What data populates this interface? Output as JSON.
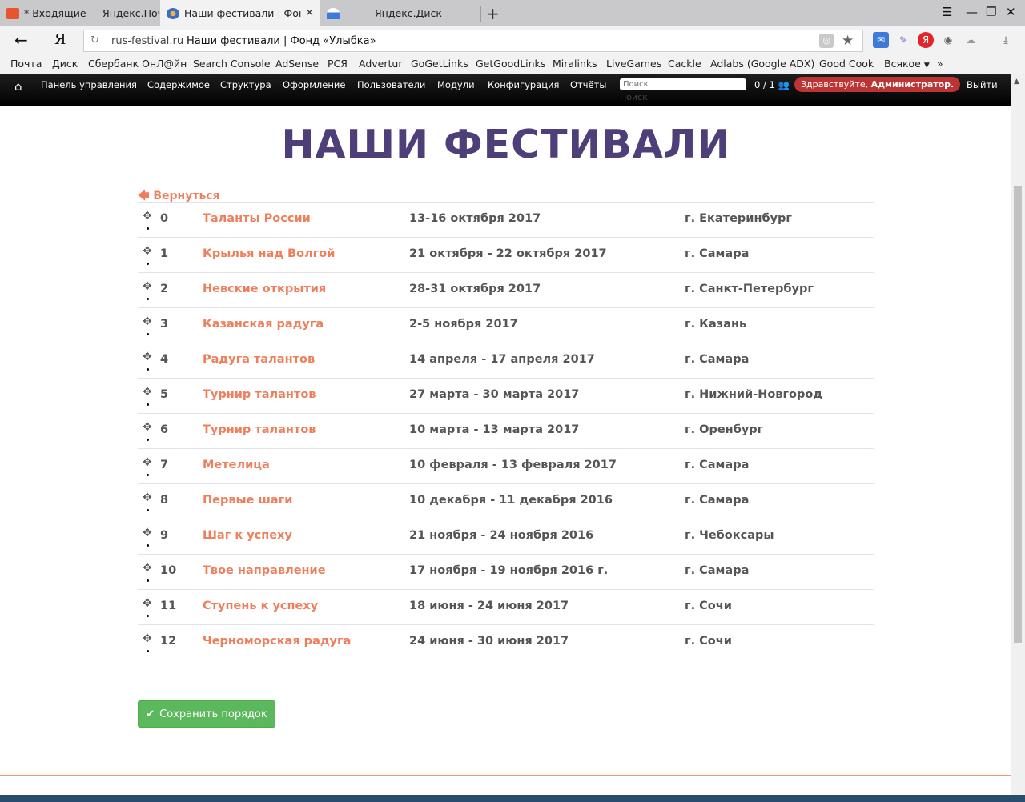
{
  "browser": {
    "tabs": [
      {
        "label": "* Входящие — Яндекс.Почта",
        "active": false
      },
      {
        "label": "Наши фестивали | Фонд «Улыбка»",
        "active": true
      },
      {
        "label": "Яндекс.Диск",
        "active": false
      }
    ],
    "address": {
      "domain": "rus-festival.ru",
      "title": "Наши фестивали | Фонд «Улыбка»"
    },
    "yandex_logo": "Я",
    "bookmarks": [
      "Почта",
      "Диск",
      "Сбербанк ОнЛ@йн",
      "Search Console",
      "AdSense",
      "РСЯ",
      "Advertur",
      "GoGetLinks",
      "GetGoodLinks",
      "Miralinks",
      "LiveGames",
      "Cackle",
      "Adlabs (Google ADX)",
      "Good Cook",
      "Всякое",
      "»"
    ]
  },
  "admin_bar": {
    "menu": [
      "Панель управления",
      "Содержимое",
      "Структура",
      "Оформление",
      "Пользователи",
      "Модули",
      "Конфигурация",
      "Отчёты"
    ],
    "search_placeholder": "Поиск",
    "search_label": "Поиск",
    "user_count": "0 / 1",
    "greeting_prefix": "Здравствуйте,",
    "greeting_user": "Администратор.",
    "logout": "Выйти"
  },
  "page": {
    "title": "НАШИ ФЕСТИВАЛИ",
    "back_link": "Вернуться",
    "save_button": "Сохранить порядок"
  },
  "festivals": [
    {
      "num": "0",
      "name": "Таланты России",
      "date": "13-16 октября 2017",
      "city": "г. Екатеринбург"
    },
    {
      "num": "1",
      "name": "Крылья над Волгой",
      "date": "21 октября - 22 октября 2017",
      "city": "г. Самара"
    },
    {
      "num": "2",
      "name": "Невские открытия",
      "date": "28-31 октября 2017",
      "city": "г. Санкт-Петербург"
    },
    {
      "num": "3",
      "name": "Казанская радуга",
      "date": "2-5 ноября 2017",
      "city": "г. Казань"
    },
    {
      "num": "4",
      "name": "Радуга талантов",
      "date": "14 апреля - 17 апреля 2017",
      "city": "г. Самара"
    },
    {
      "num": "5",
      "name": "Турнир талантов",
      "date": "27 марта - 30 марта 2017",
      "city": "г. Нижний-Новгород"
    },
    {
      "num": "6",
      "name": "Турнир талантов",
      "date": "10 марта - 13 марта 2017",
      "city": "г. Оренбург"
    },
    {
      "num": "7",
      "name": "Метелица",
      "date": "10 февраля - 13 февраля 2017",
      "city": "г. Самара"
    },
    {
      "num": "8",
      "name": "Первые шаги",
      "date": "10 декабря - 11 декабря 2016",
      "city": "г. Самара"
    },
    {
      "num": "9",
      "name": "Шаг к успеху",
      "date": "21 ноября - 24 ноября 2016",
      "city": "г. Чебоксары"
    },
    {
      "num": "10",
      "name": "Твое направление",
      "date": "17 ноября - 19 ноября 2016 г.",
      "city": "г. Самара"
    },
    {
      "num": "11",
      "name": "Ступень к успеху",
      "date": "18 июня - 24 июня 2017",
      "city": "г. Сочи"
    },
    {
      "num": "12",
      "name": "Черноморская радуга",
      "date": "24 июня - 30 июня 2017",
      "city": "г. Сочи"
    }
  ],
  "colors": {
    "title": "#4f3f79",
    "link": "#ee7f5c",
    "save_button": "#5cb85c",
    "greeting_badge": "#bd3434"
  }
}
